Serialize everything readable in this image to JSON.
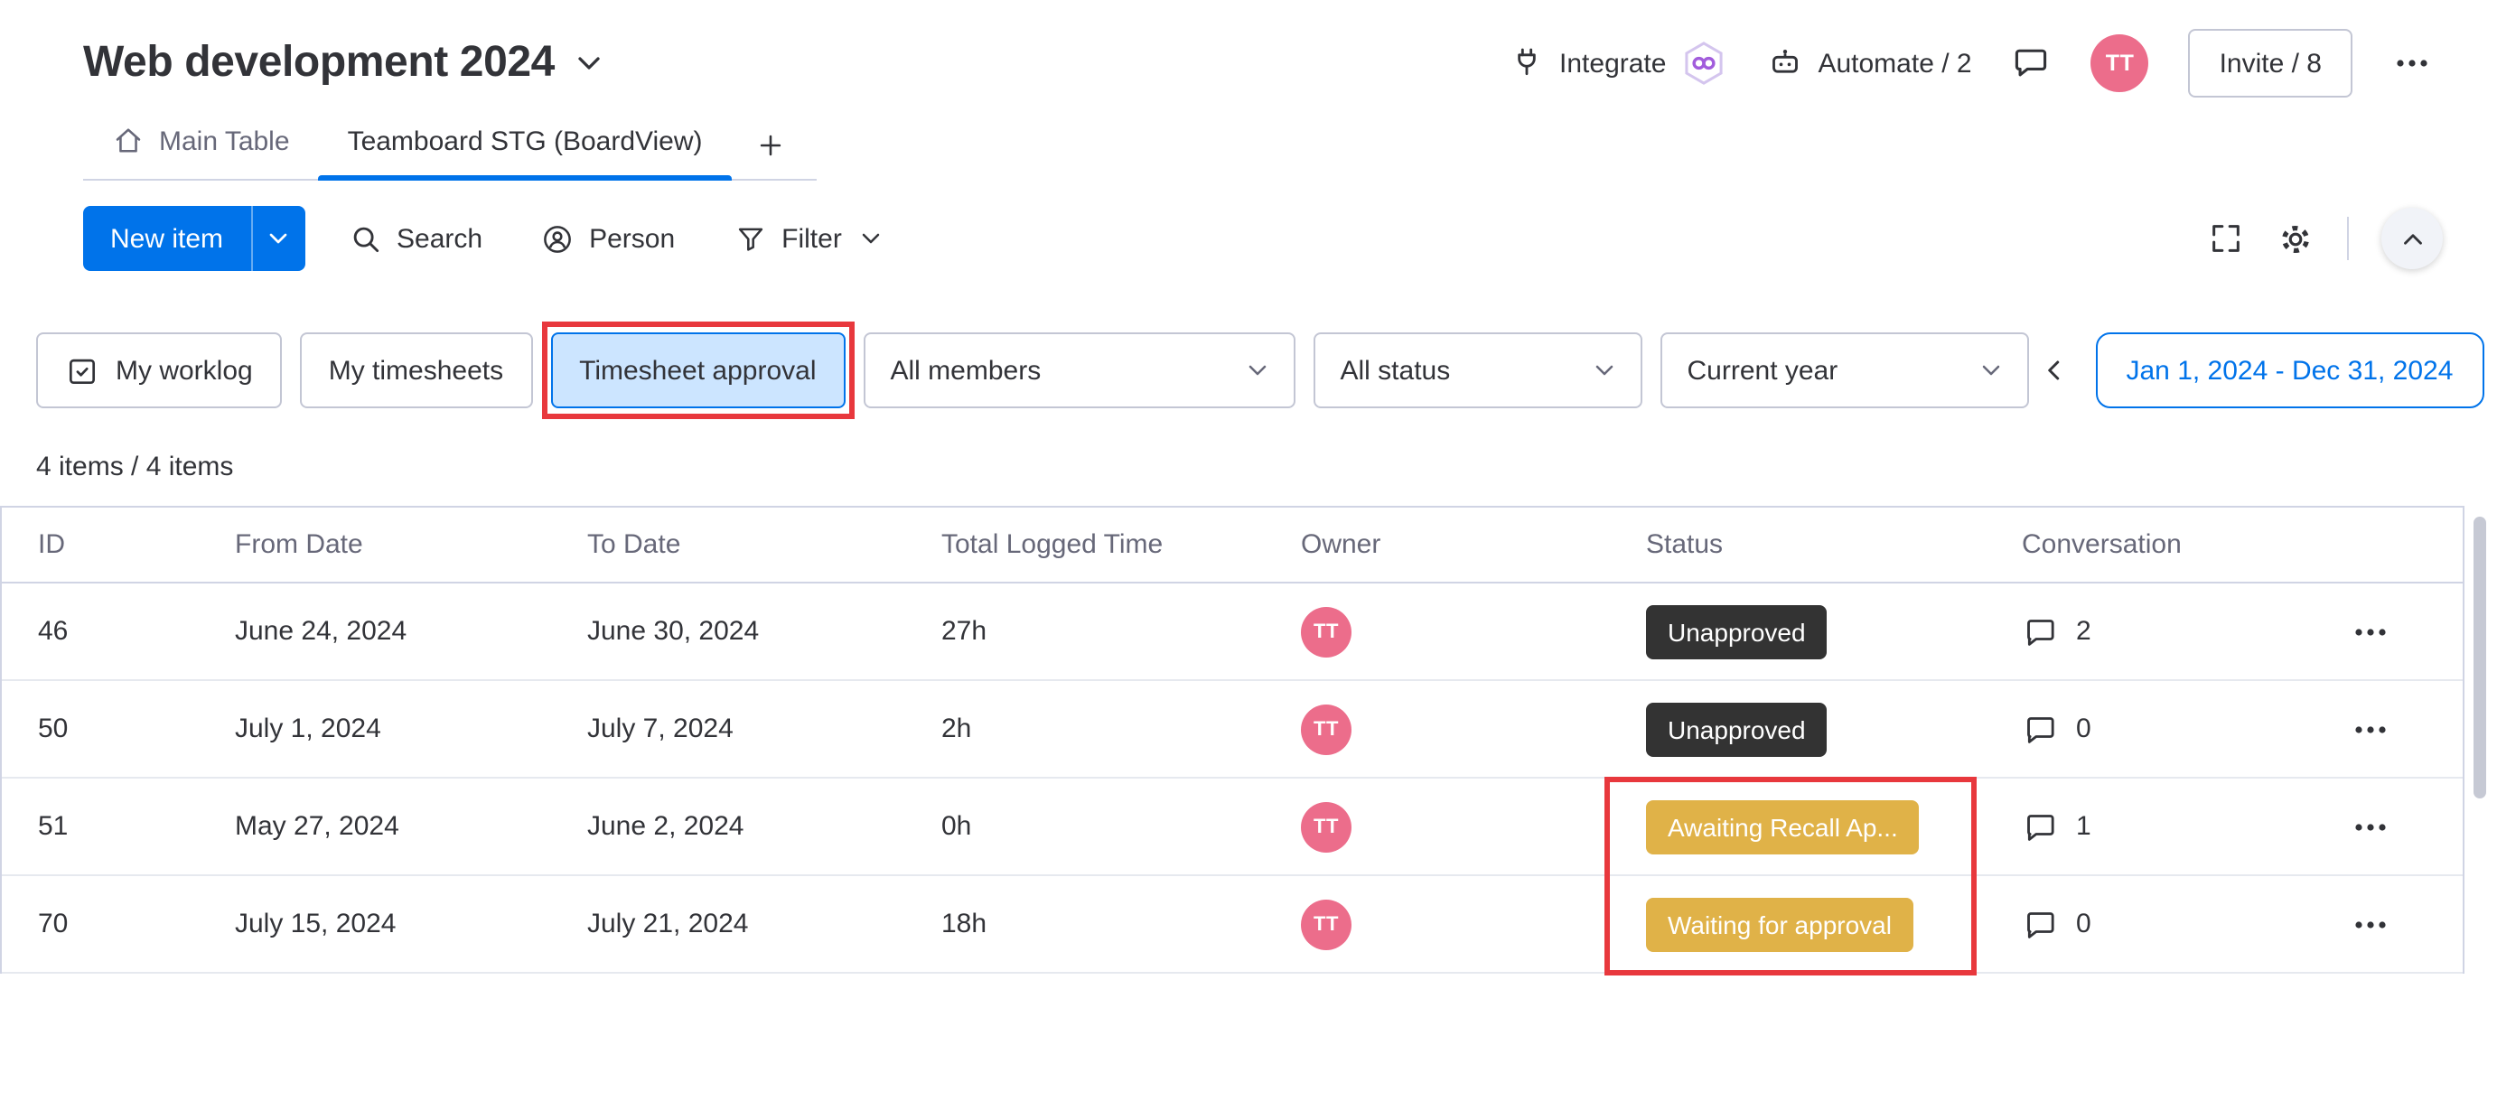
{
  "header": {
    "title": "Web development 2024",
    "integrate_label": "Integrate",
    "automate_label": "Automate / 2",
    "avatar_initials": "TT",
    "invite_label": "Invite / 8"
  },
  "tabs": {
    "main": "Main Table",
    "board": "Teamboard STG (BoardView)",
    "add": "+"
  },
  "toolbar": {
    "new_item": "New item",
    "search": "Search",
    "person": "Person",
    "filter": "Filter"
  },
  "filters": {
    "my_worklog": "My worklog",
    "my_timesheets": "My timesheets",
    "timesheet_approval": "Timesheet approval",
    "members": "All members",
    "status": "All status",
    "period": "Current year",
    "date_range": "Jan 1, 2024 - Dec 31, 2024"
  },
  "items_count": "4 items / 4 items",
  "table": {
    "columns": [
      "ID",
      "From Date",
      "To Date",
      "Total Logged Time",
      "Owner",
      "Status",
      "Conversation"
    ],
    "rows": [
      {
        "id": "46",
        "from_date": "June 24, 2024",
        "to_date": "June 30, 2024",
        "total": "27h",
        "owner": "TT",
        "status": "Unapproved",
        "status_type": "dark",
        "conversation_count": "2"
      },
      {
        "id": "50",
        "from_date": "July 1, 2024",
        "to_date": "July 7, 2024",
        "total": "2h",
        "owner": "TT",
        "status": "Unapproved",
        "status_type": "dark",
        "conversation_count": "0"
      },
      {
        "id": "51",
        "from_date": "May 27, 2024",
        "to_date": "June 2, 2024",
        "total": "0h",
        "owner": "TT",
        "status": "Awaiting Recall Ap...",
        "status_type": "gold",
        "conversation_count": "1"
      },
      {
        "id": "70",
        "from_date": "July 15, 2024",
        "to_date": "July 21, 2024",
        "total": "18h",
        "owner": "TT",
        "status": "Waiting for approval",
        "status_type": "gold",
        "conversation_count": "0"
      }
    ]
  },
  "colors": {
    "accent": "#0073ea",
    "status_dark": "#333333",
    "status_gold": "#e0b248",
    "avatar_pink": "#ec6d8b",
    "annotation_red": "#e8383d",
    "selected_filter_bg": "#cce5ff"
  }
}
